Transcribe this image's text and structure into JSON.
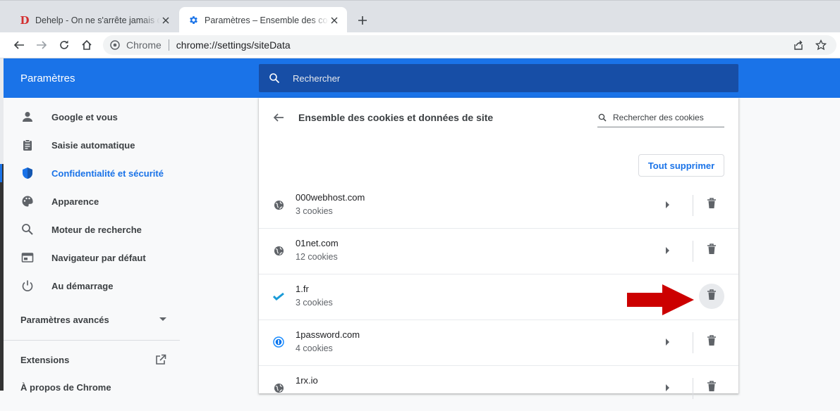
{
  "browser": {
    "tabs": [
      {
        "title": "Dehelp - On ne s'arrête jamais d'apprendre",
        "active": false,
        "favicon": "dehelp-d-logo"
      },
      {
        "title": "Paramètres – Ensemble des cookies et données de site",
        "active": true,
        "favicon": "gear-icon"
      }
    ],
    "omnibox": {
      "scheme_label": "Chrome",
      "url": "chrome://settings/siteData"
    }
  },
  "settings": {
    "header_title": "Paramètres",
    "search_placeholder": "Rechercher",
    "sidebar": {
      "items": [
        {
          "label": "Google et vous",
          "icon": "person-icon"
        },
        {
          "label": "Saisie automatique",
          "icon": "clipboard-icon"
        },
        {
          "label": "Confidentialité et sécurité",
          "icon": "shield-icon",
          "selected": true
        },
        {
          "label": "Apparence",
          "icon": "palette-icon"
        },
        {
          "label": "Moteur de recherche",
          "icon": "search-icon"
        },
        {
          "label": "Navigateur par défaut",
          "icon": "browser-window-icon"
        },
        {
          "label": "Au démarrage",
          "icon": "power-icon"
        }
      ],
      "advanced": "Paramètres avancés",
      "extensions": "Extensions",
      "about": "À propos de Chrome"
    },
    "page": {
      "title": "Ensemble des cookies et données de site",
      "cookie_search_placeholder": "Rechercher des cookies",
      "remove_all_label": "Tout supprimer",
      "sites": [
        {
          "name": "000webhost.com",
          "count": "3 cookies",
          "icon": "globe-icon"
        },
        {
          "name": "01net.com",
          "count": "12 cookies",
          "icon": "globe-icon"
        },
        {
          "name": "1.fr",
          "count": "3 cookies",
          "icon": "checkmark-favicon",
          "hovered_delete": true
        },
        {
          "name": "1password.com",
          "count": "4 cookies",
          "icon": "1password-favicon"
        },
        {
          "name": "1rx.io",
          "count": "",
          "icon": "globe-icon"
        }
      ]
    }
  },
  "annotation": {
    "type": "red-arrow",
    "points_to": "delete button of 1.fr"
  },
  "colors": {
    "accent": "#1a73e8",
    "header_search": "#174ea6",
    "arrow": "#cc0000"
  }
}
